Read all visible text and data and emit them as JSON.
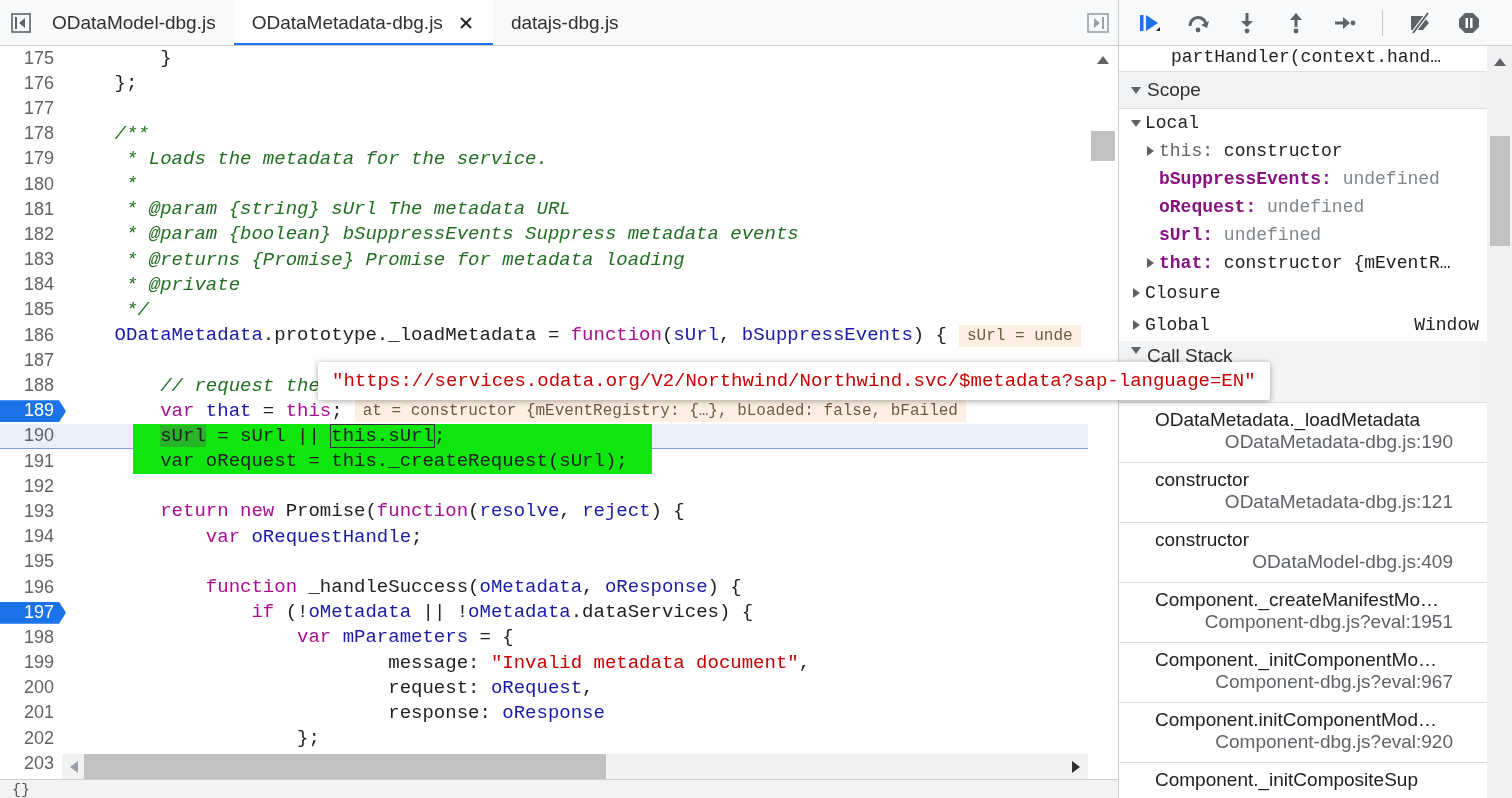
{
  "editor": {
    "tabs": [
      {
        "label": "ODataModel-dbg.js",
        "selected": false
      },
      {
        "label": "ODataMetadata-dbg.js",
        "selected": true
      },
      {
        "label": "datajs-dbg.js",
        "selected": false
      }
    ],
    "lines": [
      {
        "n": "175",
        "breakpoint": false,
        "code": [
          {
            "kind": "plain",
            "text": "        }"
          }
        ]
      },
      {
        "n": "176",
        "breakpoint": false,
        "code": [
          {
            "kind": "plain",
            "text": "    };"
          }
        ]
      },
      {
        "n": "177",
        "breakpoint": false
      },
      {
        "n": "178",
        "breakpoint": false,
        "code": [
          {
            "kind": "comment",
            "text": "    /**"
          }
        ]
      },
      {
        "n": "179",
        "breakpoint": false,
        "code": [
          {
            "kind": "comment",
            "text": "     * Loads the metadata for the service."
          }
        ]
      },
      {
        "n": "180",
        "breakpoint": false,
        "code": [
          {
            "kind": "comment",
            "text": "     *"
          }
        ]
      },
      {
        "n": "181",
        "breakpoint": false,
        "code": [
          {
            "kind": "comment",
            "text": "     * @param {string} sUrl The metadata URL"
          }
        ]
      },
      {
        "n": "182",
        "breakpoint": false,
        "code": [
          {
            "kind": "comment",
            "text": "     * @param {boolean} bSuppressEvents Suppress metadata events"
          }
        ]
      },
      {
        "n": "183",
        "breakpoint": false,
        "code": [
          {
            "kind": "comment",
            "text": "     * @returns {Promise} Promise for metadata loading"
          }
        ]
      },
      {
        "n": "184",
        "breakpoint": false,
        "code": [
          {
            "kind": "comment",
            "text": "     * @private"
          }
        ]
      },
      {
        "n": "185",
        "breakpoint": false,
        "code": [
          {
            "kind": "comment",
            "text": "     */"
          }
        ]
      },
      {
        "n": "186",
        "breakpoint": false,
        "code": [
          {
            "kind": "variable",
            "text": "    ODataMetadata"
          },
          {
            "kind": "plain",
            "text": ".prototype._loadMetadata = "
          },
          {
            "kind": "keyword",
            "text": "function"
          },
          {
            "kind": "plain",
            "text": "("
          },
          {
            "kind": "variable",
            "text": "sUrl"
          },
          {
            "kind": "plain",
            "text": ", "
          },
          {
            "kind": "variable",
            "text": "bSuppressEvents"
          },
          {
            "kind": "plain",
            "text": ") {"
          }
        ],
        "inline_value": "sUrl = unde"
      },
      {
        "n": "187",
        "breakpoint": false
      },
      {
        "n": "188",
        "breakpoint": false,
        "code": [
          {
            "kind": "comment",
            "text": "        // request the"
          }
        ]
      },
      {
        "n": "189",
        "breakpoint": true,
        "code": [
          {
            "kind": "keyword",
            "text": "        var"
          },
          {
            "kind": "variable",
            "text": " that"
          },
          {
            "kind": "plain",
            "text": " = "
          },
          {
            "kind": "keyword",
            "text": "this"
          },
          {
            "kind": "plain",
            "text": ";"
          }
        ],
        "inline_value": "at = constructor {mEventRegistry: {…}, bLoaded: false, bFailed"
      },
      {
        "n": "190",
        "breakpoint": false,
        "current": true,
        "marked": true,
        "code": [
          {
            "kind": "selected",
            "text": "        sUrl"
          },
          {
            "kind": "plain",
            "text": " = sUrl || "
          },
          {
            "kind": "hovered",
            "text": "this.sUrl"
          },
          {
            "kind": "plain",
            "text": ";"
          }
        ]
      },
      {
        "n": "191",
        "breakpoint": false,
        "current": false,
        "marked": true,
        "code": [
          {
            "kind": "plain",
            "text": "        var oRequest = this._createRequest(sUrl);"
          }
        ]
      },
      {
        "n": "192",
        "breakpoint": false
      },
      {
        "n": "193",
        "breakpoint": false,
        "code": [
          {
            "kind": "keyword",
            "text": "        return new"
          },
          {
            "kind": "plain",
            "text": " Promise("
          },
          {
            "kind": "keyword",
            "text": "function"
          },
          {
            "kind": "plain",
            "text": "("
          },
          {
            "kind": "variable",
            "text": "resolve"
          },
          {
            "kind": "plain",
            "text": ", "
          },
          {
            "kind": "variable",
            "text": "reject"
          },
          {
            "kind": "plain",
            "text": ") {"
          }
        ]
      },
      {
        "n": "194",
        "breakpoint": false,
        "code": [
          {
            "kind": "keyword",
            "text": "            var"
          },
          {
            "kind": "variable",
            "text": " oRequestHandle"
          },
          {
            "kind": "plain",
            "text": ";"
          }
        ]
      },
      {
        "n": "195",
        "breakpoint": false
      },
      {
        "n": "196",
        "breakpoint": false,
        "code": [
          {
            "kind": "keyword",
            "text": "            function"
          },
          {
            "kind": "plain",
            "text": " _handleSuccess("
          },
          {
            "kind": "variable",
            "text": "oMetadata"
          },
          {
            "kind": "plain",
            "text": ", "
          },
          {
            "kind": "variable",
            "text": "oResponse"
          },
          {
            "kind": "plain",
            "text": ") {"
          }
        ]
      },
      {
        "n": "197",
        "breakpoint": true,
        "code": [
          {
            "kind": "keyword",
            "text": "                if"
          },
          {
            "kind": "plain",
            "text": " (!"
          },
          {
            "kind": "variable",
            "text": "oMetadata"
          },
          {
            "kind": "plain",
            "text": " || !"
          },
          {
            "kind": "variable",
            "text": "oMetadata"
          },
          {
            "kind": "plain",
            "text": ".dataServices) {"
          }
        ]
      },
      {
        "n": "198",
        "breakpoint": false,
        "code": [
          {
            "kind": "keyword",
            "text": "                    var"
          },
          {
            "kind": "variable",
            "text": " mParameters"
          },
          {
            "kind": "plain",
            "text": " = {"
          }
        ]
      },
      {
        "n": "199",
        "breakpoint": false,
        "code": [
          {
            "kind": "plain",
            "text": "                            message: "
          },
          {
            "kind": "string",
            "text": "\"Invalid metadata document\""
          },
          {
            "kind": "plain",
            "text": ","
          }
        ]
      },
      {
        "n": "200",
        "breakpoint": false,
        "code": [
          {
            "kind": "plain",
            "text": "                            request: "
          },
          {
            "kind": "variable",
            "text": "oRequest"
          },
          {
            "kind": "plain",
            "text": ","
          }
        ]
      },
      {
        "n": "201",
        "breakpoint": false,
        "code": [
          {
            "kind": "plain",
            "text": "                            response: "
          },
          {
            "kind": "variable",
            "text": "oResponse"
          }
        ]
      },
      {
        "n": "202",
        "breakpoint": false,
        "code": [
          {
            "kind": "plain",
            "text": "                    };"
          }
        ]
      },
      {
        "n": "203",
        "breakpoint": false
      }
    ],
    "popover": {
      "text": "\"https://services.odata.org/V2/Northwind/Northwind.svc/$metadata?sap-language=EN\""
    },
    "status_bar": {
      "text": "{}"
    }
  },
  "debugger": {
    "controls": [
      {
        "kind": "resume",
        "highlighted": true
      },
      {
        "kind": "step-over",
        "highlighted": false
      },
      {
        "kind": "step-into",
        "highlighted": false
      },
      {
        "kind": "step-out",
        "highlighted": false
      },
      {
        "kind": "step",
        "highlighted": false
      },
      {
        "kind": "deactivate",
        "highlighted": false
      },
      {
        "kind": "pause-exceptions",
        "highlighted": false
      }
    ],
    "previous_frame": "partHandler(context.hand…",
    "scope": {
      "title": "Scope",
      "expanded": true,
      "items": [
        {
          "kind": "scope",
          "name": "Local",
          "expanded": true,
          "children": [
            {
              "kind": "receiver",
              "name": "this:",
              "value": "constructor",
              "expanded": false
            },
            {
              "kind": "property",
              "name": "bSuppressEvents:",
              "value": "undefined"
            },
            {
              "kind": "property",
              "name": "oRequest:",
              "value": "undefined"
            },
            {
              "kind": "property",
              "name": "sUrl:",
              "value": "undefined"
            },
            {
              "kind": "property",
              "name": "that:",
              "value": "constructor {mEventR…",
              "expanded": false
            }
          ]
        },
        {
          "kind": "scope",
          "name": "Closure",
          "expanded": false
        },
        {
          "kind": "scope",
          "name": "Global",
          "value": "Window",
          "expanded": false
        }
      ]
    },
    "call_stack": {
      "title": "Call Stack",
      "expanded": true,
      "frames": [
        {
          "function": "ODataMetadata._loadMetadata",
          "location": "ODataMetadata-dbg.js:190"
        },
        {
          "function": "constructor",
          "location": "ODataMetadata-dbg.js:121"
        },
        {
          "function": "constructor",
          "location": "ODataModel-dbg.js:409"
        },
        {
          "function": "Component._createManifestMo…",
          "location": "Component-dbg.js?eval:1951"
        },
        {
          "function": "Component._initComponentMo…",
          "location": "Component-dbg.js?eval:967"
        },
        {
          "function": "Component.initComponentMod…",
          "location": "Component-dbg.js?eval:920"
        },
        {
          "function": "Component._initCompositeSup"
        }
      ]
    }
  }
}
